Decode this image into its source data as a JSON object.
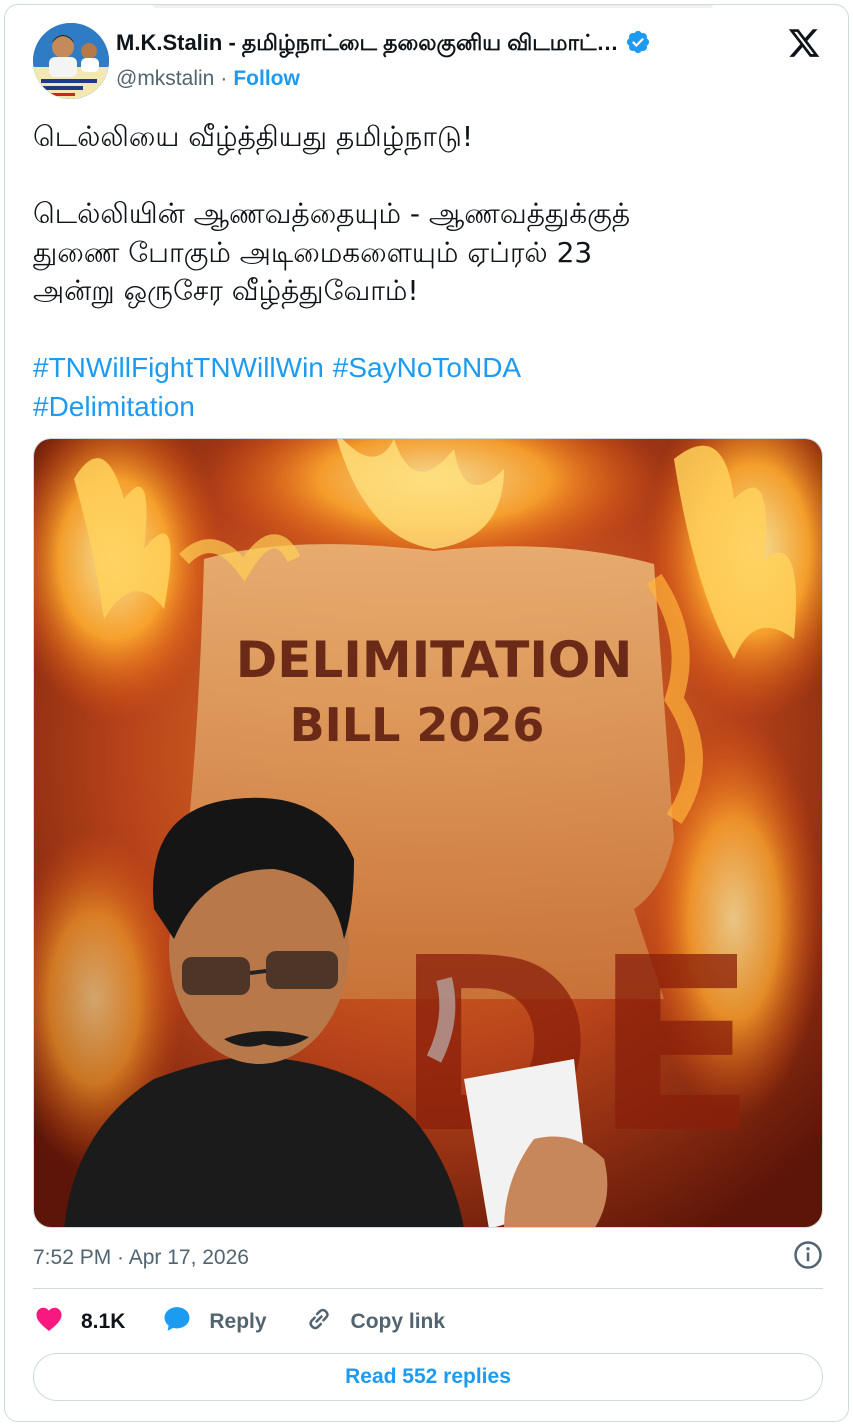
{
  "author": {
    "display_name": "M.K.Stalin - தமிழ்நாட்டை தலைகுனிய விடமாட்…",
    "handle": "@mkstalin",
    "separator": "·",
    "follow_label": "Follow"
  },
  "tweet": {
    "lines": [
      "டெல்லியை வீழ்த்தியது தமிழ்நாடு!",
      "",
      "டெல்லியின் ஆணவத்தையும் - ஆணவத்துக்குத்",
      "துணை போகும் அடிமைகளையும் ஏப்ரல் 23",
      "அன்று ஒருசேர வீழ்த்துவோம்!",
      ""
    ],
    "hashtags": [
      "#TNWillFightTNWillWin",
      "#SayNoToNDA",
      "#Delimitation"
    ]
  },
  "media": {
    "poster_line1": "DELIMITATION",
    "poster_line2": "BILL 2026",
    "big_text": "DE",
    "icons": [
      "flames-image",
      "person-image"
    ]
  },
  "meta": {
    "timestamp": "7:52 PM · Apr 17, 2026"
  },
  "actions": {
    "like_count": "8.1K",
    "reply_label": "Reply",
    "copy_label": "Copy link"
  },
  "read_replies_label": "Read 552 replies",
  "colors": {
    "accent": "#1d9bf0",
    "like": "#f91880",
    "text": "#0f1419",
    "muted": "#536471",
    "border": "#cfd9de"
  }
}
